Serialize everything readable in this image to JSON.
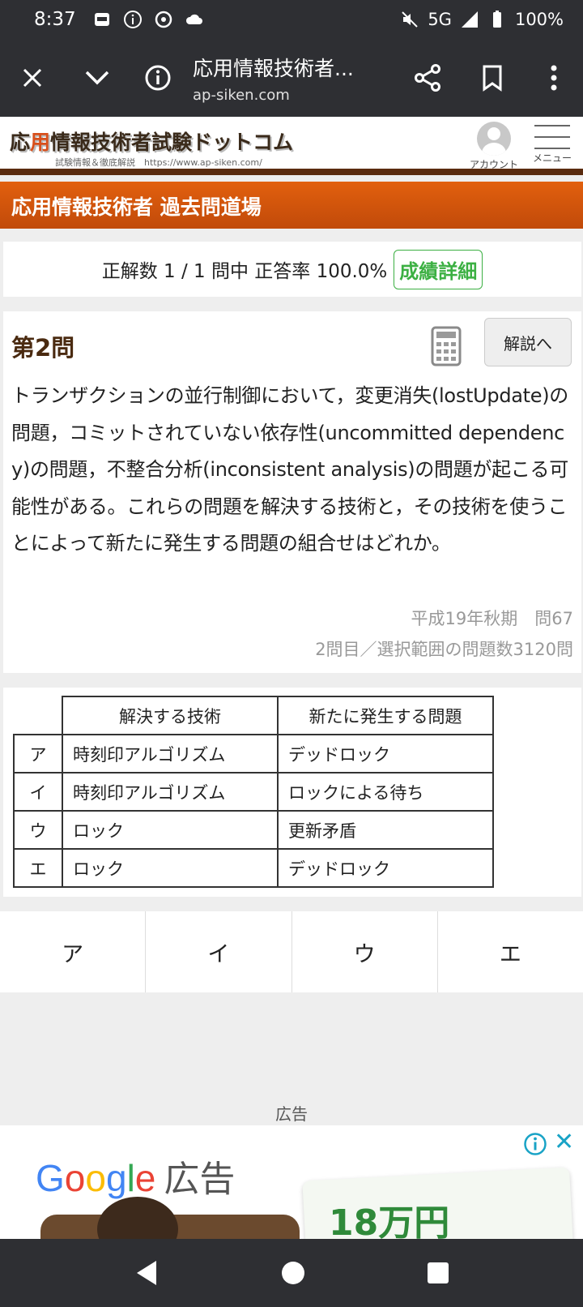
{
  "status_bar": {
    "time": "8:37",
    "network": "5G",
    "battery": "100%"
  },
  "browser": {
    "page_title": "応用情報技術者...",
    "url": "ap-siken.com"
  },
  "site_header": {
    "logo_prefix": "応",
    "logo_highlight": "用",
    "logo_rest": "情報技術者試験ドットコム",
    "logo_sub": "試験情報＆徹底解説　https://www.ap-siken.com/",
    "account_label": "アカウント",
    "menu_label": "メニュー"
  },
  "banner": {
    "title": "応用情報技術者 過去問道場"
  },
  "score": {
    "text": "正解数 1 / 1 問中 正答率 100.0%",
    "detail_button": "成績詳細"
  },
  "question": {
    "title": "第2問",
    "explain_button": "解説へ",
    "text": "トランザクションの並行制御において，変更消失(lostUpdate)の問題，コミットされていない依存性(uncommitted dependency)の問題，不整合分析(inconsistent analysis)の問題が起こる可能性がある。これらの問題を解決する技術と，その技術を使うことによって新たに発生する問題の組合せはどれか。",
    "source": "平成19年秋期　問67",
    "progress": "2問目／選択範囲の問題数3120問"
  },
  "choices_table": {
    "headers": [
      "解決する技術",
      "新たに発生する問題"
    ],
    "rows": [
      {
        "symbol": "ア",
        "technique": "時刻印アルゴリズム",
        "problem": "デッドロック"
      },
      {
        "symbol": "イ",
        "technique": "時刻印アルゴリズム",
        "problem": "ロックによる待ち"
      },
      {
        "symbol": "ウ",
        "technique": "ロック",
        "problem": "更新矛盾"
      },
      {
        "symbol": "エ",
        "technique": "ロック",
        "problem": "デッドロック"
      }
    ]
  },
  "answers": [
    "ア",
    "イ",
    "ウ",
    "エ"
  ],
  "ad": {
    "label": "広告",
    "brand": [
      "G",
      "o",
      "o",
      "g",
      "l",
      "e"
    ],
    "brand_suffix": "広告",
    "price": "18万円"
  },
  "colors": {
    "banner": "#d4560c",
    "header_border": "#5a2b0f",
    "accent_green": "#3cb043",
    "system_bar": "#2e2f33"
  }
}
